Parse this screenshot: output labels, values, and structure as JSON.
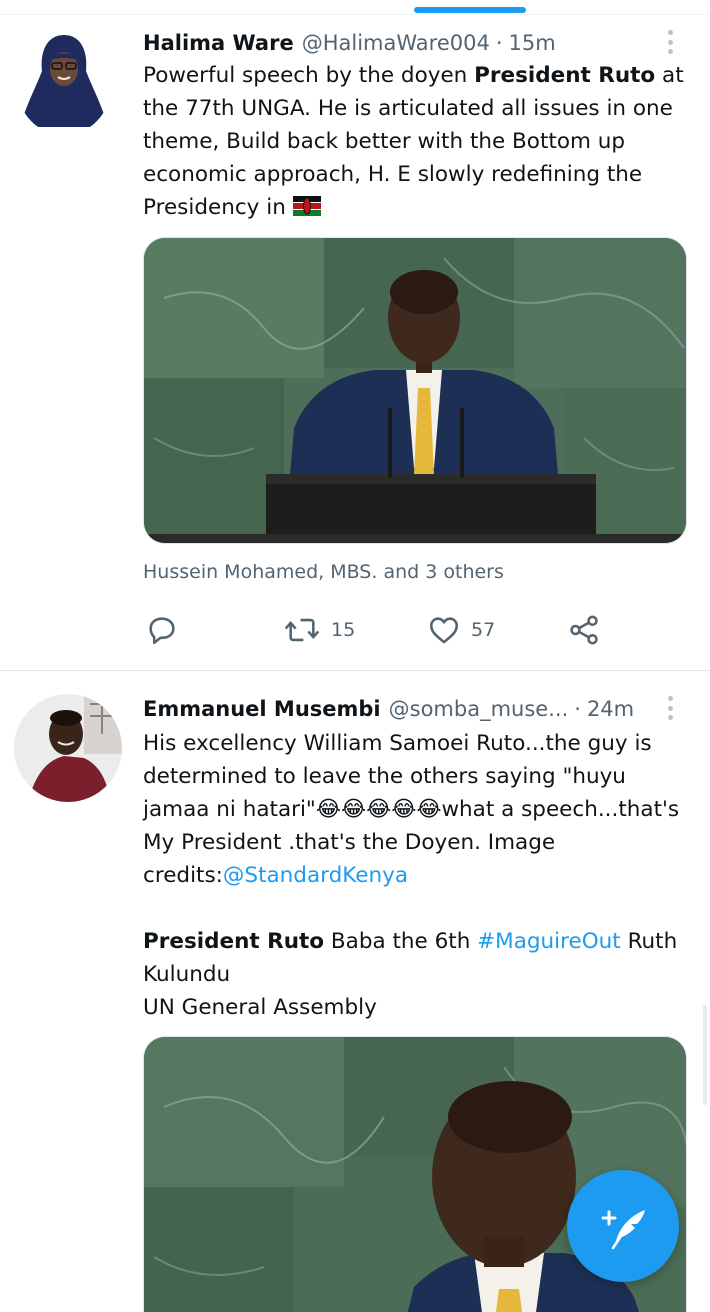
{
  "tweets": [
    {
      "author_name": "Halima Ware",
      "handle": "@HalimaWare004",
      "separator": "·",
      "time": "15m",
      "text_parts": {
        "p1": "Powerful speech by the doyen ",
        "b1": "President Ruto",
        "p2": " at the 77th UNGA. He is articulated all issues in one theme, Build back better with the Bottom up economic approach, H. E slowly redefining the Presidency in "
      },
      "flag_emoji": "Kenya flag",
      "tagged_people": "Hussein Mohamed, MBS. and 3 others",
      "retweets": "15",
      "likes": "57"
    },
    {
      "author_name": "Emmanuel Musembi",
      "handle": "@somba_muse...",
      "separator": "·",
      "time": "24m",
      "text_parts": {
        "p1": "His excellency William Samoei Ruto...the guy is determined to leave the others saying \"huyu jamaa ni hatari\"",
        "emojis": "😂😂😂😂😂",
        "p2": "what a speech...that's My President .that's the Doyen. Image credits:",
        "mention": "@StandardKenya",
        "b1": "President Ruto",
        "p3": " Baba the 6th ",
        "hashtag": "#MaguireOut",
        "p4": " Ruth Kulundu",
        "line3": "UN General Assembly"
      }
    }
  ],
  "icons": {
    "reply": "reply-icon",
    "retweet": "retweet-icon",
    "like": "heart-icon",
    "share": "share-icon",
    "compose": "compose-feather-icon",
    "more": "more-vertical-icon"
  },
  "colors": {
    "accent": "#1d9bf0",
    "secondary_text": "#536471",
    "primary_text": "#0f1419"
  }
}
